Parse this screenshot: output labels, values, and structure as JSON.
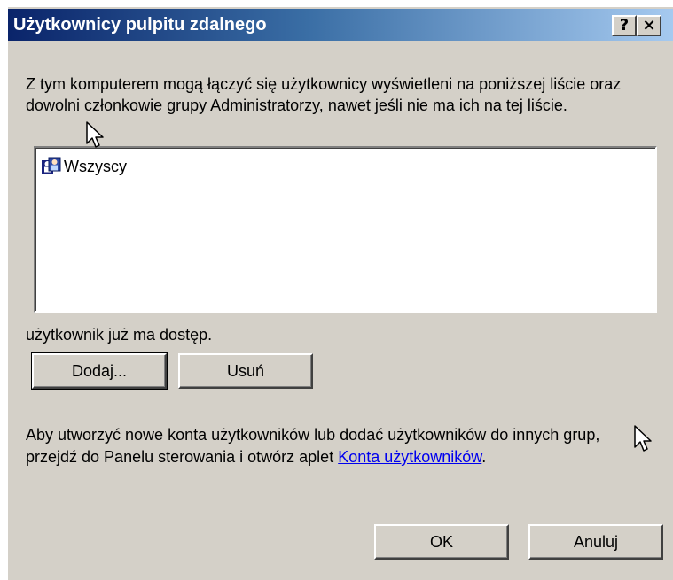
{
  "window": {
    "title": "Użytkownicy pulpitu zdalnego",
    "help_glyph": "?",
    "close_glyph": "×"
  },
  "intro_text": "Z tym komputerem mogą łączyć się użytkownicy wyświetleni na poniższej liście oraz dowolni członkowie grupy Administratorzy, nawet jeśli nie ma ich na tej liście.",
  "users_list": {
    "items": [
      {
        "label": "Wszyscy",
        "icon": "users-group-icon"
      }
    ]
  },
  "access_status": "użytkownik już ma dostęp.",
  "buttons": {
    "add": "Dodaj...",
    "remove": "Usuń",
    "ok": "OK",
    "cancel": "Anuluj"
  },
  "footer": {
    "text_before_link": "Aby utworzyć nowe konta użytkowników lub dodać użytkowników do innych grup, przejdź do Panelu sterowania i otwórz aplet ",
    "link_text": "Konta użytkowników",
    "text_after_link": "."
  },
  "colors": {
    "titlebar_start": "#0a246a",
    "titlebar_end": "#a6caf0",
    "dialog_bg": "#d4d0c8",
    "link": "#0000ee"
  }
}
